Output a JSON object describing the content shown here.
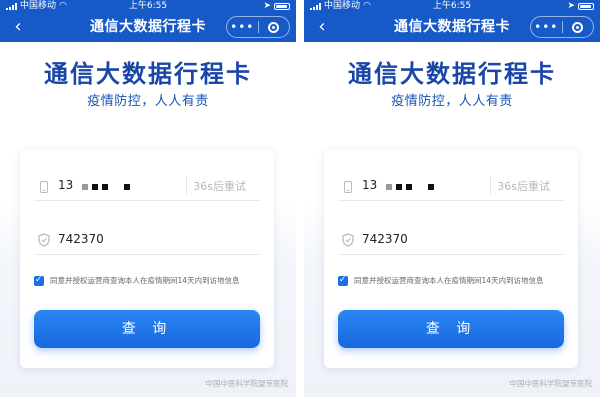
{
  "panels": [
    {
      "status": {
        "carrier": "中国移动",
        "time": "上午6:55"
      },
      "nav": {
        "back": "‹",
        "title": "通信大数据行程卡",
        "more": "•••"
      },
      "headline": "通信大数据行程卡",
      "subline": "疫情防控，人人有责",
      "phone": {
        "value": "13",
        "retry": "36s后重试"
      },
      "code": {
        "value": "742370"
      },
      "agreement": "同意并授权运营商查询本人在疫情期间14天内到访地信息",
      "query_button": "查 询",
      "watermark": "中国中医科学院望京医院"
    },
    {
      "status": {
        "carrier": "中国移动",
        "time": "上午6:55"
      },
      "nav": {
        "back": "‹",
        "title": "通信大数据行程卡",
        "more": "•••"
      },
      "headline": "通信大数据行程卡",
      "subline": "疫情防控，人人有责",
      "phone": {
        "value": "13",
        "retry": "36s后重试"
      },
      "code": {
        "value": "742370"
      },
      "agreement": "同意并授权运营商查询本人在疫情期间14天内到访地信息",
      "query_button": "查 询",
      "watermark": "中国中医科学院望京医院"
    }
  ],
  "colors": {
    "nav_blue": "#1659c7",
    "headline": "#1a46a8",
    "button": "#1768e0"
  },
  "icons": [
    "chevron-left-icon",
    "more-icon",
    "record-icon",
    "phone-icon",
    "shield-icon",
    "checkbox-icon",
    "wifi-icon",
    "battery-icon"
  ]
}
